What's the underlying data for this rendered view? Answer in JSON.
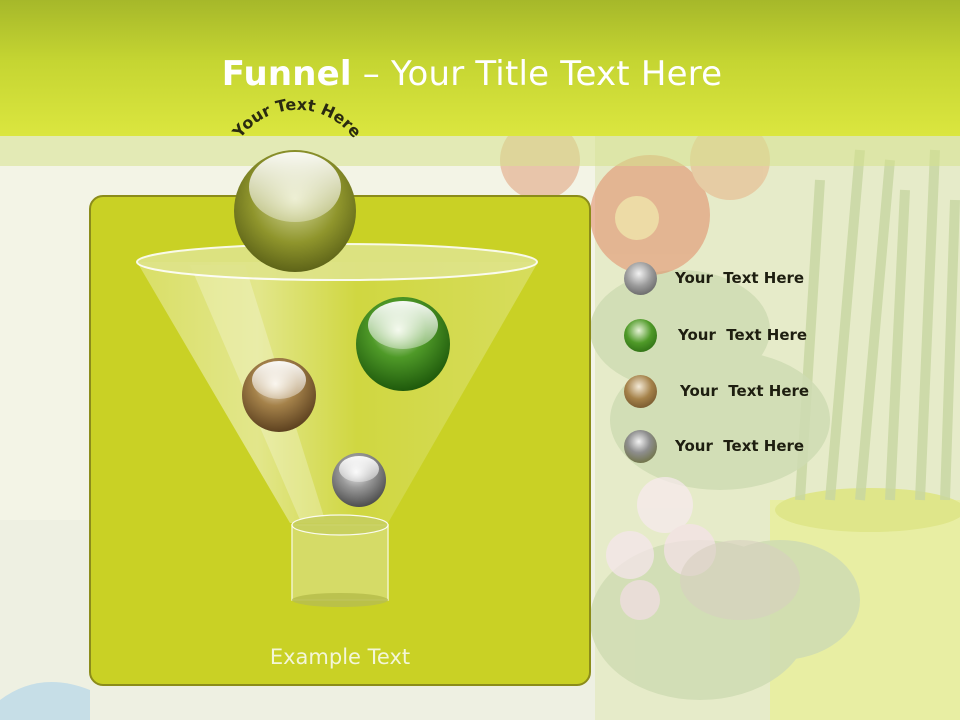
{
  "title": {
    "bold": "Funnel",
    "rest": " – Your Title Text Here"
  },
  "funnel": {
    "top_label": "Your Text Here",
    "bottom_label": "Example Text"
  },
  "legend": [
    {
      "label": "Your  Text Here",
      "color": "#7a7a7a"
    },
    {
      "label": "Your  Text Here",
      "color": "#3f8a1e"
    },
    {
      "label": "Your  Text Here",
      "color": "#8a7030"
    },
    {
      "label": "Your  Text Here",
      "color": "#7a7a7a"
    }
  ],
  "colors": {
    "header": "#c5d532",
    "panel": "#c9d125",
    "panel_border": "#8b8c1a",
    "gray_ball": "#7c7c7c",
    "green_ball": "#3e8a1d",
    "brown_ball": "#8b6b3a"
  }
}
